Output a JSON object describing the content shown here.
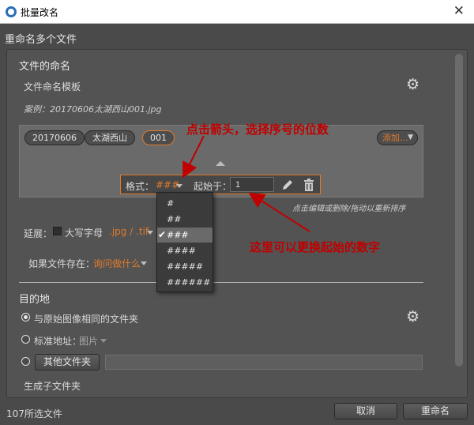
{
  "window": {
    "title": "批量改名",
    "close_icon": "close-icon"
  },
  "dialog_heading": "重命名多个文件",
  "naming": {
    "section_title": "文件的命名",
    "template_label": "文件命名模板",
    "example": "案例：20170606太湖西山001.jpg",
    "tokens": [
      "20170606",
      "太湖西山",
      "001"
    ],
    "add_label": "添加...",
    "hint": "点击编辑或删除/拖动以重新排序"
  },
  "format_bar": {
    "format_label": "格式：",
    "format_value": "###",
    "start_label": "起始于：",
    "start_value": "1"
  },
  "dropdown": {
    "options": [
      "#",
      "##",
      "###",
      "####",
      "#####",
      "######"
    ],
    "selected_index": 2
  },
  "options": {
    "extension_label": "延展：",
    "uppercase_label": "大写字母",
    "ext_value": ".jpg / .tif",
    "exists_label": "如果文件存在：",
    "exists_value": "询问做什么"
  },
  "destination": {
    "section_title": "目的地",
    "same_folder_label": "与原始图像相同的文件夹",
    "standard_label": "标准地址：",
    "standard_value": "图片",
    "other_folder_button": "其他文件夹",
    "subfolder_label": "生成子文件夹"
  },
  "footer": {
    "selected_count": "107所选文件",
    "cancel": "取消",
    "rename": "重命名"
  },
  "annotations": {
    "arrow_text": "点击箭头，选择序号的位数",
    "start_text": "这里可以更换起始的数字"
  },
  "colors": {
    "accent": "#e07a2a",
    "annotation": "#c00000"
  }
}
